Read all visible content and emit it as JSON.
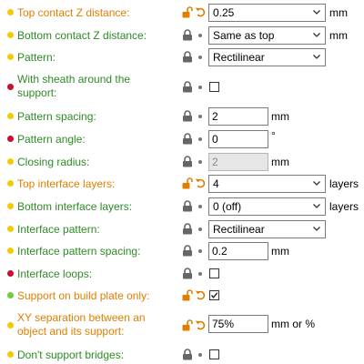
{
  "colors": {
    "dot_yellow": "#f2cb05",
    "dot_red": "#c8102e",
    "dot_green": "#6fcf3a",
    "label_green": "#2e8b25",
    "label_orange": "#e07e00",
    "lock_gray": "#666666",
    "lock_orange": "#e07e00"
  },
  "rows": [
    {
      "label": "Top contact Z distance:",
      "dot": "yellow",
      "label_color": "orange",
      "lock": "unlocked-orange",
      "state": "undo",
      "value": "0.25",
      "unit": "mm"
    },
    {
      "label": "Bottom contact Z distance:",
      "dot": "yellow",
      "label_color": "green",
      "lock": "locked-gray",
      "state": "bullet",
      "value": "Same as top",
      "unit": "mm"
    },
    {
      "label": "Pattern:",
      "dot": "yellow",
      "label_color": "green",
      "lock": "locked-gray",
      "state": "bullet",
      "value": "Rectilinear",
      "unit": ""
    },
    {
      "label": "With sheath around the support:",
      "dot": "red",
      "label_color": "green",
      "lock": "locked-gray",
      "state": "bullet",
      "checked": false
    },
    {
      "label": "Pattern spacing:",
      "dot": "yellow",
      "label_color": "green",
      "lock": "locked-gray",
      "state": "bullet",
      "value": "2",
      "unit": "mm"
    },
    {
      "label": "Pattern angle:",
      "dot": "red",
      "label_color": "green",
      "lock": "locked-gray",
      "state": "bullet",
      "value": "0",
      "unit": "°"
    },
    {
      "label": "Closing radius:",
      "dot": "yellow",
      "label_color": "green",
      "lock": "locked-gray",
      "state": "bullet",
      "value": "2",
      "unit": "mm"
    },
    {
      "label": "Top interface layers:",
      "dot": "yellow",
      "label_color": "orange",
      "lock": "unlocked-orange",
      "state": "undo",
      "value": "4",
      "unit": "layers"
    },
    {
      "label": "Bottom interface layers:",
      "dot": "yellow",
      "label_color": "green",
      "lock": "locked-gray",
      "state": "bullet",
      "value": "0 (off)",
      "unit": "layers"
    },
    {
      "label": "Interface pattern:",
      "dot": "yellow",
      "label_color": "green",
      "lock": "locked-gray",
      "state": "bullet",
      "value": "Rectilinear",
      "unit": ""
    },
    {
      "label": "Interface pattern spacing:",
      "dot": "yellow",
      "label_color": "green",
      "lock": "locked-gray",
      "state": "bullet",
      "value": "0.2",
      "unit": "mm"
    },
    {
      "label": "Interface loops:",
      "dot": "red",
      "label_color": "green",
      "lock": "locked-gray",
      "state": "bullet",
      "checked": false
    },
    {
      "label": "Support on build plate only:",
      "dot": "green",
      "label_color": "orange",
      "lock": "unlocked-orange",
      "state": "undo",
      "checked": true
    },
    {
      "label": "XY separation between an object and its support:",
      "dot": "yellow",
      "label_color": "orange",
      "lock": "unlocked-orange",
      "state": "undo",
      "value": "75%",
      "unit": "mm or %"
    },
    {
      "label": "Don't support bridges:",
      "dot": "yellow",
      "label_color": "green",
      "lock": "locked-gray",
      "state": "bullet",
      "checked": false
    }
  ]
}
